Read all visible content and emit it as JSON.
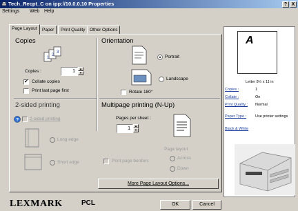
{
  "window": {
    "title": "Tech_Recpt_C on ipp://10.0.0.10 Properties",
    "help_btn": "?",
    "close_btn": "X"
  },
  "menu": {
    "settings": "Settings",
    "web": "Web",
    "help": "Help"
  },
  "tabs": [
    "Page Layout",
    "Paper",
    "Print Quality",
    "Other Options"
  ],
  "copies": {
    "header": "Copies",
    "label": "Copies :",
    "value": "1",
    "collate": "Collate copies",
    "collate_checked": true,
    "print_last_first": "Print last page first",
    "print_last_checked": false
  },
  "orientation": {
    "header": "Orientation",
    "portrait": "Portrait",
    "landscape": "Landscape",
    "selected": "portrait",
    "rotate": "Rotate 180°"
  },
  "two_sided": {
    "header": "2-sided printing",
    "checkbox": "2-sided printing",
    "long_edge": "Long edge",
    "short_edge": "Short edge"
  },
  "multipage": {
    "header": "Multipage printing (N-Up)",
    "pages_per_sheet_label": "Pages per sheet :",
    "pages_per_sheet": "1",
    "print_page_borders": "Print page borders",
    "page_layout_label": "Page layout",
    "across": "Across",
    "down": "Down"
  },
  "buttons": {
    "more_layout": "More Page Layout Options...",
    "ok": "OK",
    "cancel": "Cancel"
  },
  "preview": {
    "page_letter": "A",
    "paper_size": "Letter 8½ x 11 in",
    "rows": [
      {
        "key": "Copies :",
        "value": "1"
      },
      {
        "key": "Collate :",
        "value": "On"
      },
      {
        "key": "Print Quality :",
        "value": "Normal"
      },
      {
        "key": "Paper Type :",
        "value": "Use printer settings"
      }
    ],
    "color_mode": "Black & White"
  },
  "brand": {
    "name": "LEXMARK",
    "mode": "PCL"
  },
  "colors": {
    "titlebar_start": "#0a246a",
    "titlebar_end": "#a6caf0",
    "link": "#1a3d9e",
    "chrome": "#d4d0c8"
  }
}
